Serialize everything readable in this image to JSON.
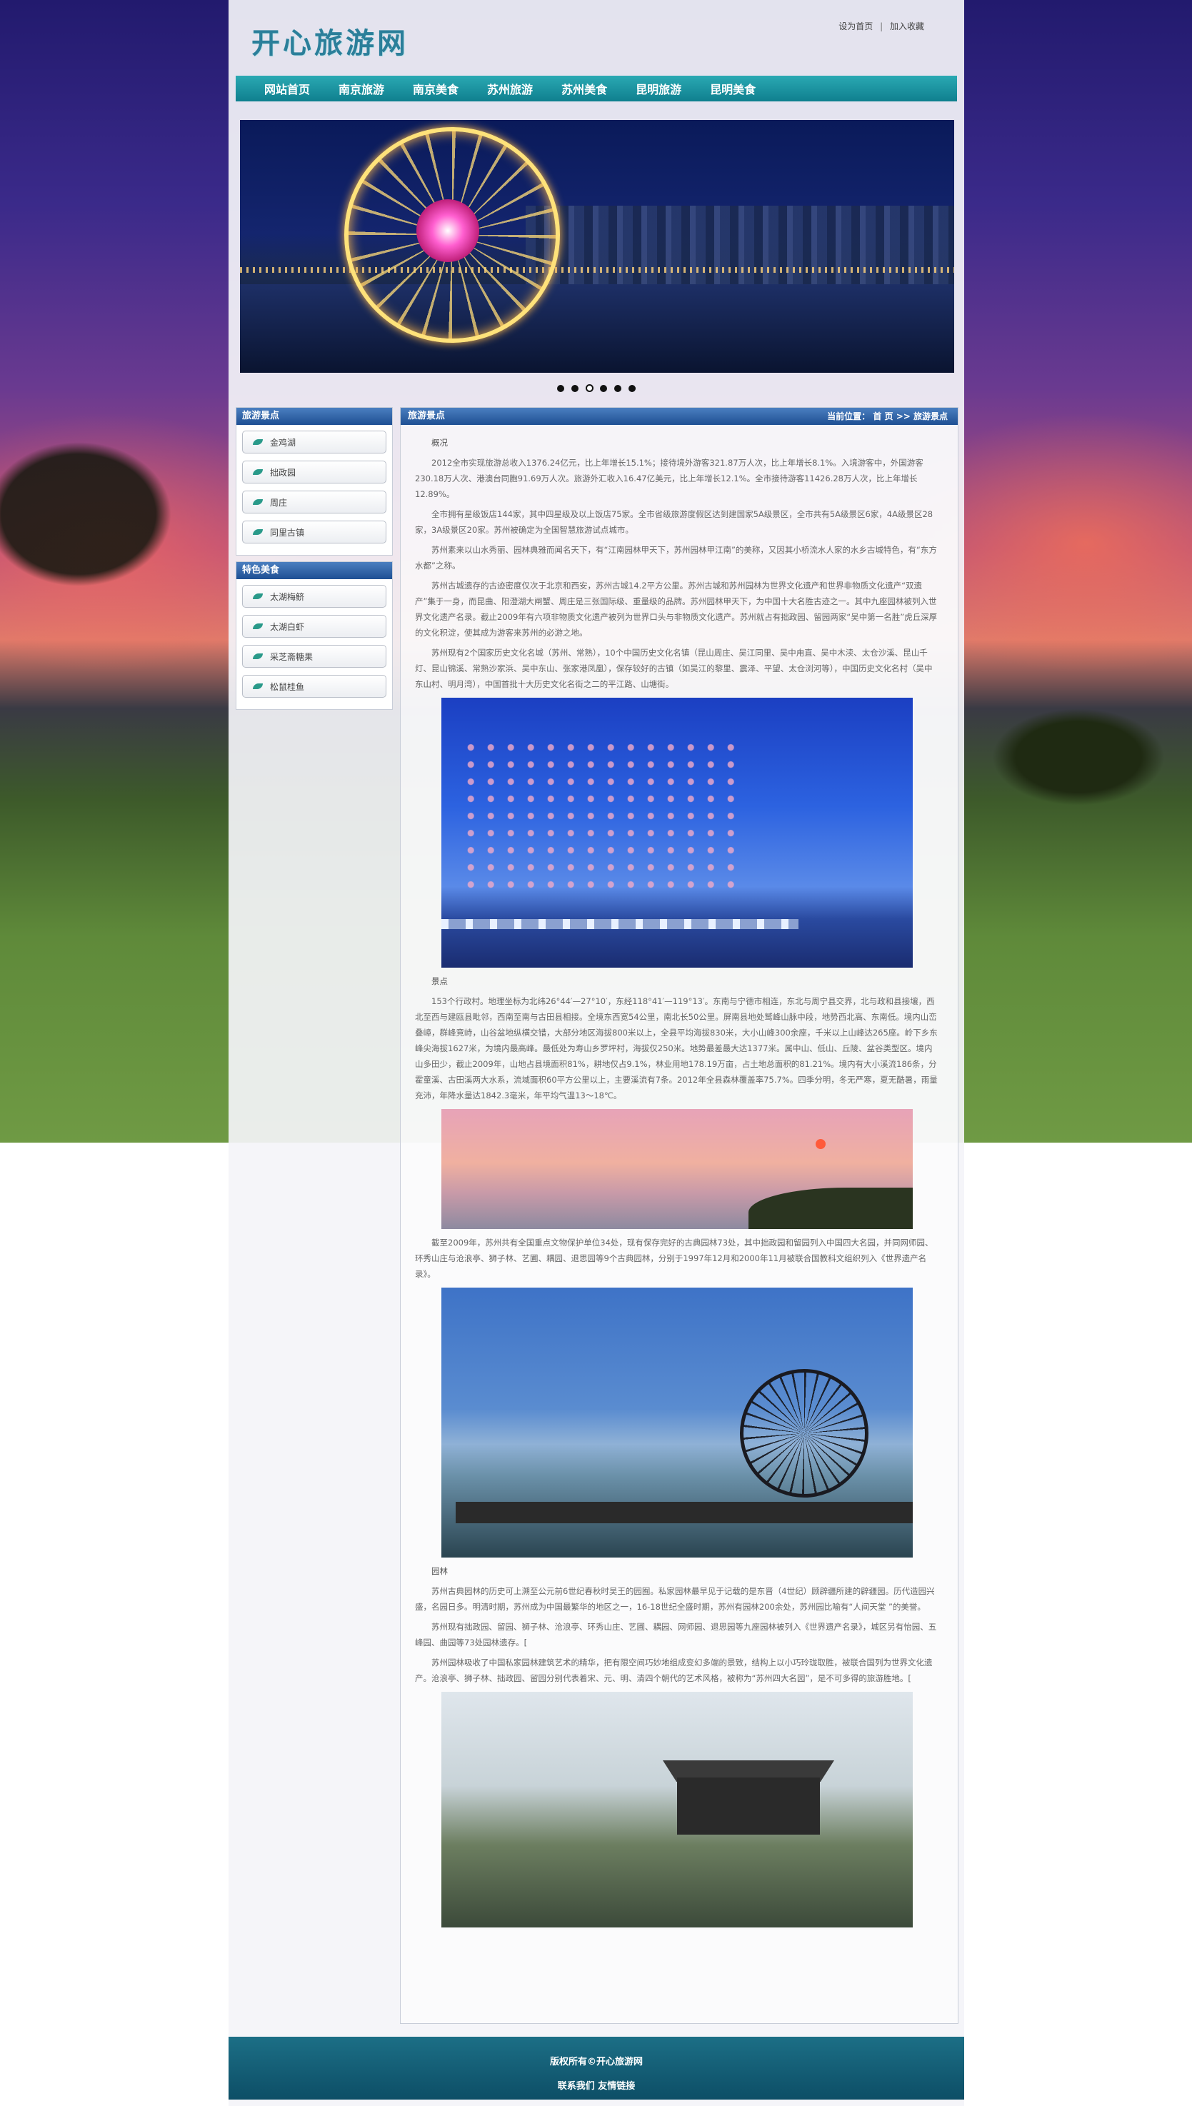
{
  "header": {
    "logo": "开心旅游网",
    "set_home": "设为首页",
    "separator": "|",
    "add_favorite": "加入收藏"
  },
  "nav": {
    "items": [
      "网站首页",
      "南京旅游",
      "南京美食",
      "苏州旅游",
      "苏州美食",
      "昆明旅游",
      "昆明美食"
    ]
  },
  "banner": {
    "slides_total": 6,
    "active_slide": 3
  },
  "sidebar": {
    "sections": [
      {
        "title": "旅游景点",
        "items": [
          "金鸡湖",
          "拙政园",
          "周庄",
          "同里古镇"
        ]
      },
      {
        "title": "特色美食",
        "items": [
          "太湖梅鲚",
          "太湖白虾",
          "采芝斋糖果",
          "松鼠桂鱼"
        ]
      }
    ]
  },
  "content": {
    "title": "旅游景点",
    "breadcrumb_prefix": "当前位置：",
    "breadcrumb_home": "首 页",
    "breadcrumb_sep": ">>",
    "breadcrumb_current": "旅游景点",
    "heading_overview": "概况",
    "p1": "2012全市实现旅游总收入1376.24亿元，比上年增长15.1%；接待境外游客321.87万人次，比上年增长8.1%。入境游客中，外国游客230.18万人次、港澳台同胞91.69万人次。旅游外汇收入16.47亿美元，比上年增长12.1%。全市接待游客11426.28万人次，比上年增长12.89%。",
    "p2": "全市拥有星级饭店144家，其中四星级及以上饭店75家。全市省级旅游度假区达到建国家5A级景区，全市共有5A级景区6家，4A级景区28家，3A级景区20家。苏州被确定为全国智慧旅游试点城市。",
    "p3": "苏州素来以山水秀丽、园林典雅而闻名天下，有“江南园林甲天下，苏州园林甲江南”的美称，又因其小桥流水人家的水乡古城特色，有“东方水都”之称。",
    "p4": "苏州古城遗存的古迹密度仅次于北京和西安，苏州古城14.2平方公里。苏州古城和苏州园林为世界文化遗产和世界非物质文化遗产“双遗产”集于一身，而昆曲、阳澄湖大闸蟹、周庄是三张国际级、重量级的品牌。苏州园林甲天下，为中国十大名胜古迹之一。其中九座园林被列入世界文化遗产名录。截止2009年有六项非物质文化遗产被列为世界口头与非物质文化遗产。苏州就占有拙政园、留园两家“吴中第一名胜”虎丘深厚的文化积淀，使其成为游客来苏州的必游之地。",
    "p5": "苏州现有2个国家历史文化名城（苏州、常熟），10个中国历史文化名镇（昆山周庄、吴江同里、吴中甪直、吴中木渎、太仓沙溪、昆山千灯、昆山锦溪、常熟沙家浜、吴中东山、张家港凤凰），保存较好的古镇（如吴江的黎里、震泽、平望、太仓浏河等），中国历史文化名村（吴中东山村、明月湾），中国首批十大历史文化名街之二的平江路、山塘街。",
    "heading_scenic": "景点",
    "p6": "153个行政村。地理坐标为北纬26°44′—27°10′，东经118°41′—119°13′。东南与宁德市相连，东北与周宁县交界，北与政和县接壤，西北至西与建瓯县毗邻，西南至南与古田县相接。全境东西宽54公里，南北长50公里。屏南县地处鹫峰山脉中段，地势西北高、东南低。境内山峦叠嶂，群峰竞峙，山谷盆地纵横交错，大部分地区海拔800米以上，全县平均海拔830米，大小山峰300余座，千米以上山峰达265座。岭下乡东峰尖海拔1627米，为境内最高峰。最低处为寿山乡罗坪村，海拔仅250米。地势最差最大达1377米。属中山、低山、丘陵、盆谷类型区。境内山多田少，截止2009年，山地占县境面积81%，耕地仅占9.1%，林业用地178.19万亩，占土地总面积的81.21%。境内有大小溪流186条，分霍童溪、古田溪两大水系，流域面积60平方公里以上，主要溪流有7条。2012年全县森林覆盖率75.7%。四季分明，冬无严寒，夏无酷暑，雨量充沛，年降水量达1842.3毫米，年平均气温13～18℃。",
    "p7": "截至2009年，苏州共有全国重点文物保护单位34处，现有保存完好的古典园林73处，其中拙政园和留园列入中国四大名园，并同网师园、环秀山庄与沧浪亭、狮子林、艺圃、耦园、退思园等9个古典园林，分别于1997年12月和2000年11月被联合国教科文组织列入《世界遗产名录》。",
    "heading_garden": "园林",
    "p8": "苏州古典园林的历史可上溯至公元前6世纪春秋时吴王的园囿。私家园林最早见于记载的是东晋（4世纪）顾辟疆所建的辟疆园。历代造园兴盛，名园日多。明清时期，苏州成为中国最繁华的地区之一，16-18世纪全盛时期，苏州有园林200余处，苏州园比喻有“人间天堂 ”的美誉。",
    "p9": "苏州现有拙政园、留园、狮子林、沧浪亭、环秀山庄、艺圃、耦园、网师园、退思园等九座园林被列入《世界遗产名录》，城区另有怡园、五峰园、曲园等73处园林遗存。[",
    "p10": "苏州园林吸收了中国私家园林建筑艺术的精华，把有限空间巧妙地组成变幻多端的景致，结构上以小巧玲珑取胜，被联合国列为世界文化遗产。沧浪亭、狮子林、拙政园、留园分别代表着宋、元、明、清四个朝代的艺术风格，被称为“苏州四大名园”，是不可多得的旅游胜地。["
  },
  "footer": {
    "copyright": "版权所有©开心旅游网",
    "links": "联系我们 友情链接"
  }
}
